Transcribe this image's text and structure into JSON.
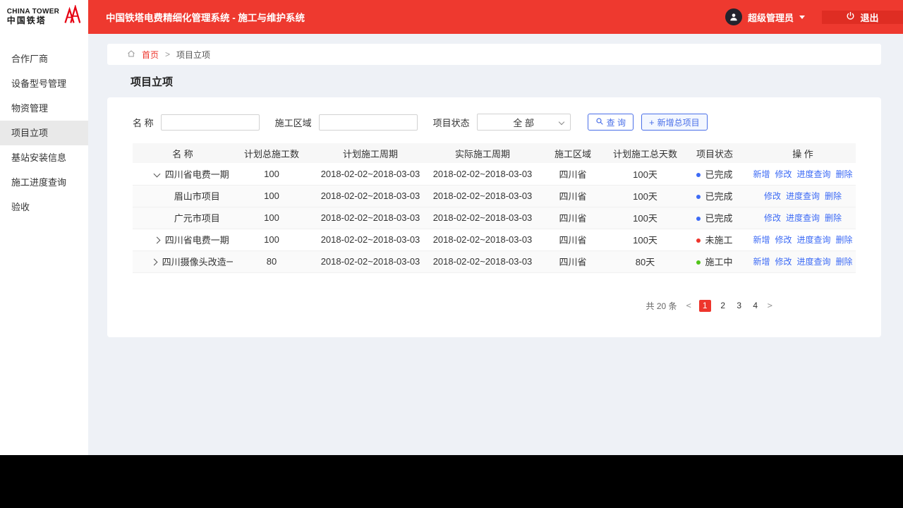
{
  "colors": {
    "brand_red": "#ee352c",
    "link_blue": "#3d6bf5",
    "status_done": "#3d6bf5",
    "status_not_started": "#ee352c",
    "status_in_progress": "#52c41a"
  },
  "header": {
    "logo_line1": "CHINA TOWER",
    "logo_line2": "中国铁塔",
    "title": "中国铁塔电费精细化管理系统 - 施工与维护系统",
    "user": "超级管理员",
    "logout_label": "退出"
  },
  "sidebar": {
    "items": [
      {
        "label": "合作厂商",
        "active": false
      },
      {
        "label": "设备型号管理",
        "active": false
      },
      {
        "label": "物资管理",
        "active": false
      },
      {
        "label": "项目立项",
        "active": true
      },
      {
        "label": "基站安装信息",
        "active": false
      },
      {
        "label": "施工进度查询",
        "active": false
      },
      {
        "label": "验收",
        "active": false
      }
    ]
  },
  "breadcrumb": {
    "home": "首页",
    "separator": ">",
    "current": "项目立项"
  },
  "page_title": "项目立项",
  "filters": {
    "name_label": "名 称",
    "name_value": "",
    "region_label": "施工区域",
    "region_value": "",
    "status_label": "项目状态",
    "status_value": "全 部",
    "search_button": "查 询",
    "add_icon": "+",
    "add_button": "新增总项目"
  },
  "table": {
    "headers": [
      "名 称",
      "计划总施工数",
      "计划施工周期",
      "实际施工周期",
      "施工区域",
      "计划施工总天数",
      "项目状态",
      "操 作"
    ],
    "rows": [
      {
        "name": "四川省电费一期",
        "planned_count": "100",
        "planned_period": "2018-02-02~2018-03-03",
        "actual_period": "2018-02-02~2018-03-03",
        "region": "四川省",
        "planned_days": "100天",
        "status": "已完成",
        "status_color": "#3d6bf5",
        "actions": [
          "新增",
          "修改",
          "进度查询",
          "删除"
        ]
      },
      {
        "name": "眉山市项目",
        "planned_count": "100",
        "planned_period": "2018-02-02~2018-03-03",
        "actual_period": "2018-02-02~2018-03-03",
        "region": "四川省",
        "planned_days": "100天",
        "status": "已完成",
        "status_color": "#3d6bf5",
        "actions": [
          "修改",
          "进度查询",
          "删除"
        ]
      },
      {
        "name": "广元市项目",
        "planned_count": "100",
        "planned_period": "2018-02-02~2018-03-03",
        "actual_period": "2018-02-02~2018-03-03",
        "region": "四川省",
        "planned_days": "100天",
        "status": "已完成",
        "status_color": "#3d6bf5",
        "actions": [
          "修改",
          "进度查询",
          "删除"
        ]
      },
      {
        "name": "四川省电费一期",
        "planned_count": "100",
        "planned_period": "2018-02-02~2018-03-03",
        "actual_period": "2018-02-02~2018-03-03",
        "region": "四川省",
        "planned_days": "100天",
        "status": "未施工",
        "status_color": "#ee352c",
        "actions": [
          "新增",
          "修改",
          "进度查询",
          "删除"
        ]
      },
      {
        "name": "四川摄像头改造一期",
        "planned_count": "80",
        "planned_period": "2018-02-02~2018-03-03",
        "actual_period": "2018-02-02~2018-03-03",
        "region": "四川省",
        "planned_days": "80天",
        "status": "施工中",
        "status_color": "#52c41a",
        "actions": [
          "新增",
          "修改",
          "进度查询",
          "删除"
        ]
      }
    ]
  },
  "pagination": {
    "total": "共 20 条",
    "prev": "<",
    "pages": [
      "1",
      "2",
      "3",
      "4"
    ],
    "active_page": "1",
    "next": ">"
  }
}
